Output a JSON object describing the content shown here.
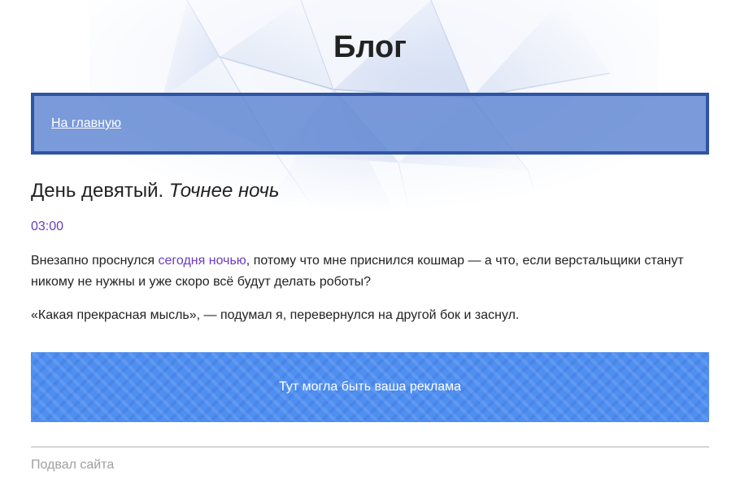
{
  "header": {
    "title": "Блог"
  },
  "nav": {
    "home_link": "На главную"
  },
  "post": {
    "title_plain": "День девятый.",
    "title_italic": "Точнее ночь",
    "time": "03:00",
    "paragraph1_before": "Внезапно проснулся ",
    "paragraph1_link": "сегодня ночью",
    "paragraph1_after": ", потому что мне приснился кошмар — а что, если верстальщики станут никому не нужны и уже скоро всё будут делать роботы?",
    "paragraph2": "«Какая прекрасная мысль», — подумал я, перевернулся на другой бок и заснул."
  },
  "ad": {
    "text": "Тут могла быть ваша реклама"
  },
  "footer": {
    "text": "Подвал сайта"
  },
  "colors": {
    "nav_border": "#2f54a3",
    "nav_bg": "#547dce",
    "link_purple": "#6a3cc4",
    "ad_bg": "#4f8ff0",
    "footer_text": "#a0a0a0"
  }
}
